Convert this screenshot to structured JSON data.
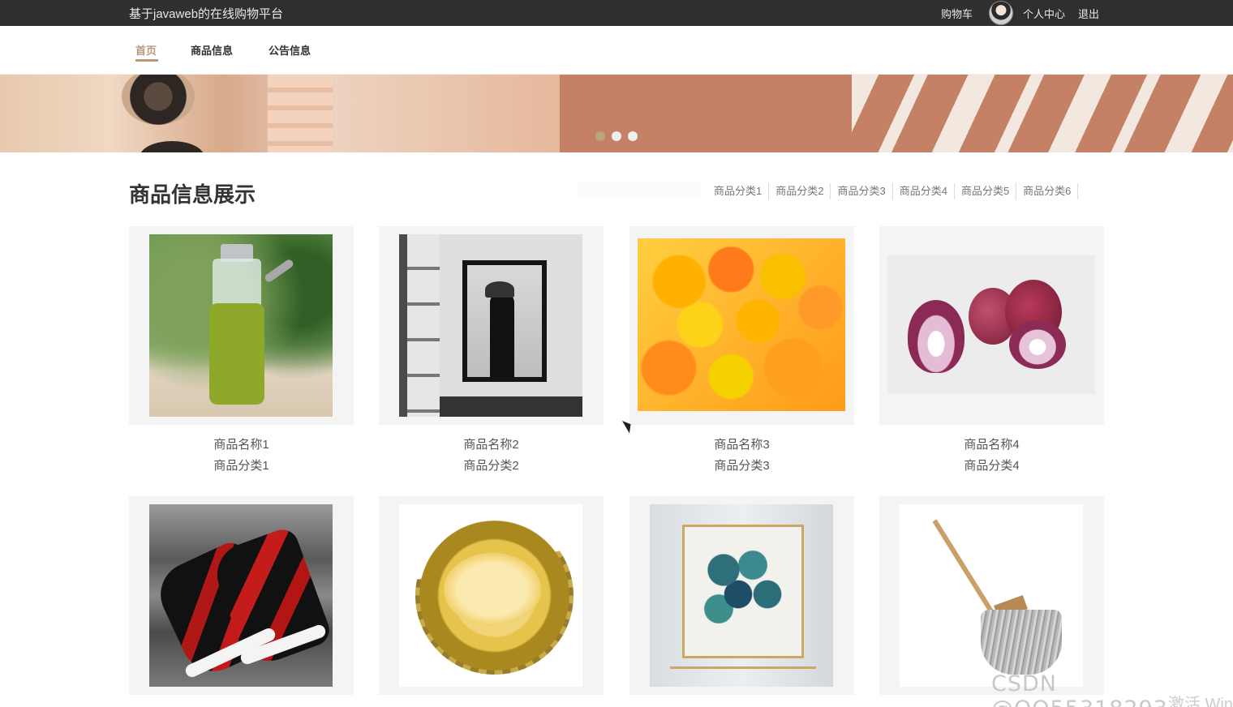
{
  "app": {
    "title": "基于javaweb的在线购物平台"
  },
  "topbar": {
    "cart": "购物车",
    "profile": "个人中心",
    "logout": "退出"
  },
  "nav": {
    "items": [
      {
        "label": "首页",
        "active": true
      },
      {
        "label": "商品信息"
      },
      {
        "label": "公告信息"
      }
    ]
  },
  "banner": {
    "slides": 3,
    "active_slide": 1
  },
  "section": {
    "title": "商品信息展示",
    "search_placeholder": ""
  },
  "categories": [
    "商品分类1",
    "商品分类2",
    "商品分类3",
    "商品分类4",
    "商品分类5",
    "商品分类6"
  ],
  "products": [
    {
      "name": "商品名称1",
      "category": "商品分类1"
    },
    {
      "name": "商品名称2",
      "category": "商品分类2"
    },
    {
      "name": "商品名称3",
      "category": "商品分类3"
    },
    {
      "name": "商品名称4",
      "category": "商品分类4"
    },
    {
      "name": "",
      "category": ""
    },
    {
      "name": "",
      "category": ""
    },
    {
      "name": "",
      "category": ""
    },
    {
      "name": "",
      "category": ""
    }
  ],
  "colors": {
    "accent": "#b89a79",
    "topbar_bg": "#2f2f2f",
    "card_bg": "#f4f4f4"
  },
  "overlay": {
    "watermark": "CSDN @QQ55318293",
    "os_notice": "激活 Win"
  }
}
